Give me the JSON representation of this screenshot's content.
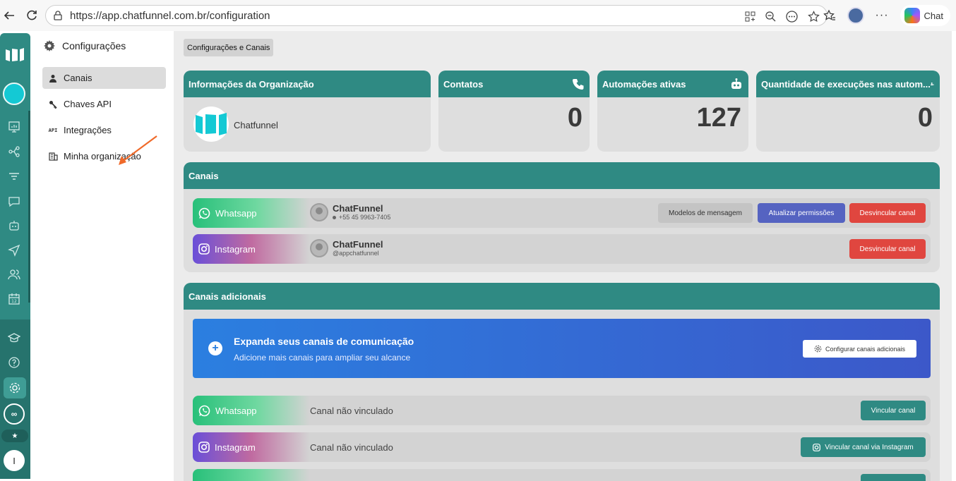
{
  "browser": {
    "url": "https://app.chatfunnel.com.br/configuration",
    "chat_label": "Chat"
  },
  "rail": {
    "user_initial": "I",
    "infinity": "∞",
    "star": "★"
  },
  "sidebar": {
    "title": "Configurações",
    "items": [
      {
        "label": "Canais",
        "icon": "person-icon"
      },
      {
        "label": "Chaves API",
        "icon": "key-icon"
      },
      {
        "label": "Integrações",
        "icon_text": "API"
      },
      {
        "label": "Minha organização",
        "icon": "building-icon"
      }
    ]
  },
  "main": {
    "breadcrumb": "Configurações e Canais",
    "org": {
      "title": "Informações da Organização",
      "name": "Chatfunnel"
    },
    "stats": [
      {
        "title": "Contatos",
        "value": "0",
        "icon": "phone-icon"
      },
      {
        "title": "Automações ativas",
        "value": "127",
        "icon": "robot-icon"
      },
      {
        "title": "Quantidade de execuções nas autom...",
        "value": "0",
        "icon": "user-cog-icon"
      }
    ],
    "channels": {
      "title": "Canais",
      "rows": [
        {
          "type": "Whatsapp",
          "name": "ChatFunnel",
          "sub": "+55 45 9963-7405",
          "buttons": [
            "Modelos de mensagem",
            "Atualizar permissões",
            "Desvincular canal"
          ]
        },
        {
          "type": "Instagram",
          "name": "ChatFunnel",
          "sub": "@appchatfunnel",
          "buttons": [
            "Desvincular canal"
          ]
        }
      ]
    },
    "additional": {
      "title": "Canais adicionais",
      "promo_title": "Expanda seus canais de comunicação",
      "promo_sub": "Adicione mais canais para ampliar seu alcance",
      "promo_button": "Configurar canais adicionais",
      "rows": [
        {
          "type": "Whatsapp",
          "status": "Canal não vinculado",
          "button": "Vincular canal"
        },
        {
          "type": "Instagram",
          "status": "Canal não vinculado",
          "button": "Vincular canal via Instagram"
        }
      ]
    }
  },
  "colors": {
    "teal": "#2f8a83",
    "red": "#e0463f",
    "blue": "#5563c1",
    "annotation": "#f06a2a"
  }
}
